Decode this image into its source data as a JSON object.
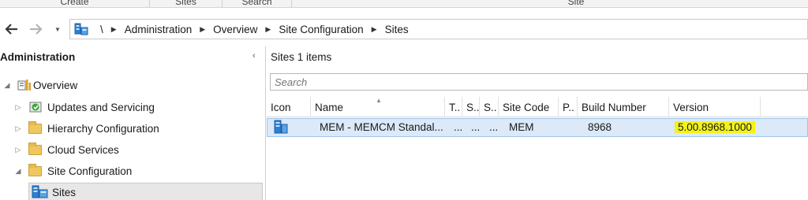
{
  "ribbon": {
    "groups": [
      "Create",
      "Sites",
      "Search",
      "Site"
    ]
  },
  "nav": {
    "breadcrumb": [
      "\\",
      "Administration",
      "Overview",
      "Site Configuration",
      "Sites"
    ]
  },
  "left_pane": {
    "title": "Administration",
    "collapse_glyph": "‹",
    "tree": [
      {
        "label": "Overview",
        "icon": "overview-icon",
        "expanded": true
      },
      {
        "label": "Updates and Servicing",
        "icon": "updates-icon",
        "expanded": false
      },
      {
        "label": "Hierarchy Configuration",
        "icon": "folder-icon",
        "expanded": false
      },
      {
        "label": "Cloud Services",
        "icon": "folder-icon",
        "expanded": false
      },
      {
        "label": "Site Configuration",
        "icon": "folder-icon",
        "expanded": true
      },
      {
        "label": "Sites",
        "icon": "sites-icon",
        "selected": true
      }
    ]
  },
  "main": {
    "title": "Sites 1 items",
    "search_placeholder": "Search",
    "columns": [
      "Icon",
      "Name",
      "T..",
      "S..",
      "S..",
      "Site Code",
      "P..",
      "Build Number",
      "Version"
    ],
    "rows": [
      {
        "icon": "site-server-icon",
        "name": "MEM - MEMCM Standal...",
        "t": "...",
        "s1": "...",
        "s2": "...",
        "site_code": "MEM",
        "p": "",
        "build_number": "8968",
        "version": "5.00.8968.1000"
      }
    ]
  },
  "colors": {
    "highlight": "#f2f21a",
    "row_selected": "#dbe9f8",
    "folder": "#f0c75e"
  }
}
